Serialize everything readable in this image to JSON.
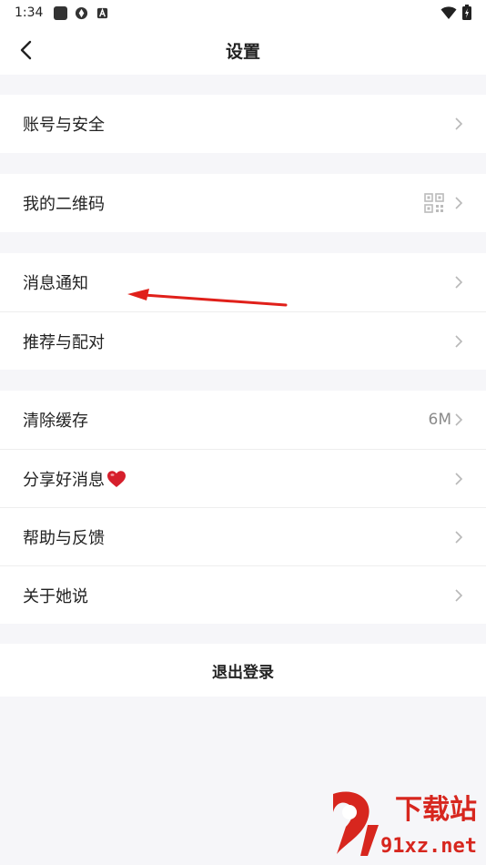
{
  "status_bar": {
    "time": "1:34"
  },
  "nav": {
    "title": "设置"
  },
  "groups": [
    {
      "rows": [
        {
          "label": "账号与安全",
          "value": ""
        }
      ]
    },
    {
      "rows": [
        {
          "label": "我的二维码",
          "value": ""
        }
      ]
    },
    {
      "rows": [
        {
          "label": "消息通知",
          "value": ""
        },
        {
          "label": "推荐与配对",
          "value": ""
        }
      ]
    },
    {
      "rows": [
        {
          "label": "清除缓存",
          "value": "6M"
        },
        {
          "label": "分享好消息",
          "value": ""
        },
        {
          "label": "帮助与反馈",
          "value": ""
        },
        {
          "label": "关于她说",
          "value": ""
        }
      ]
    }
  ],
  "logout": {
    "label": "退出登录"
  },
  "watermark": {
    "cn": "下载站",
    "en": "91xz.net"
  },
  "colors": {
    "annotation_arrow": "#e0201a",
    "chevron": "#b8b8b8"
  }
}
